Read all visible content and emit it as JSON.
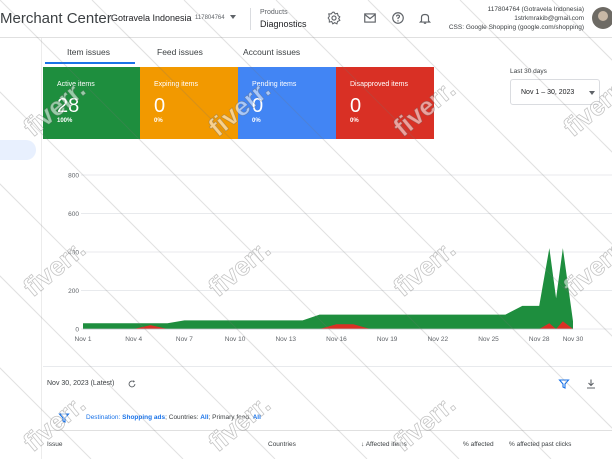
{
  "header": {
    "app_title": "Merchant Center",
    "account_name": "Gotravela Indonesia",
    "account_id": "117804764",
    "breadcrumb_parent": "Products",
    "breadcrumb_current": "Diagnostics",
    "account_lines": [
      "117804764 (Gotravela Indonesia)",
      "1strkmrakib@gmail.com",
      "CSS: Google Shopping (google.com/shopping)"
    ],
    "icons": [
      "settings-icon",
      "mail-icon",
      "help-icon",
      "notifications-icon"
    ]
  },
  "tabs": [
    {
      "label": "Item issues",
      "active": true
    },
    {
      "label": "Feed issues",
      "active": false
    },
    {
      "label": "Account issues",
      "active": false
    }
  ],
  "cards": [
    {
      "label": "Active items",
      "value": "28",
      "pct": "100%",
      "color": "#1e8e3e"
    },
    {
      "label": "Expiring items",
      "value": "0",
      "pct": "0%",
      "color": "#f29900"
    },
    {
      "label": "Pending items",
      "value": "0",
      "pct": "0%",
      "color": "#4285f4"
    },
    {
      "label": "Disapproved items",
      "value": "0",
      "pct": "0%",
      "color": "#d93025"
    }
  ],
  "date_range": {
    "label": "Last 30 days",
    "value": "Nov 1 – 30, 2023"
  },
  "chart_data": {
    "type": "area",
    "y_ticks": [
      "800",
      "600",
      "400",
      "200",
      "0"
    ],
    "ylim": [
      0,
      800
    ],
    "x_ticks": [
      "Nov 1",
      "Nov 4",
      "Nov 7",
      "Nov 10",
      "Nov 13",
      "Nov 16",
      "Nov 19",
      "Nov 22",
      "Nov 25",
      "Nov 28",
      "Nov 30"
    ],
    "x": [
      1,
      2,
      3,
      4,
      5,
      6,
      7,
      8,
      9,
      10,
      11,
      12,
      13,
      14,
      15,
      16,
      17,
      18,
      19,
      20,
      21,
      22,
      23,
      24,
      25,
      26,
      27,
      28,
      28.6,
      29,
      29.4,
      30
    ],
    "series": [
      {
        "color": "#1e8e3e",
        "values": [
          30,
          30,
          30,
          30,
          30,
          30,
          45,
          45,
          45,
          45,
          45,
          45,
          45,
          45,
          75,
          75,
          75,
          75,
          75,
          75,
          75,
          75,
          75,
          75,
          75,
          75,
          120,
          120,
          420,
          160,
          420,
          40
        ]
      },
      {
        "color": "#d93025",
        "values": [
          0,
          0,
          0,
          0,
          20,
          0,
          0,
          0,
          0,
          0,
          0,
          0,
          0,
          0,
          0,
          25,
          25,
          0,
          0,
          0,
          0,
          0,
          0,
          0,
          0,
          0,
          0,
          0,
          30,
          0,
          40,
          0
        ]
      }
    ],
    "grid": true
  },
  "issues": {
    "latest_label": "Nov 30, 2023 (Latest)",
    "filter": {
      "destination_key": "Destination:",
      "destination_val": "Shopping ads",
      "countries_key": "Countries:",
      "countries_val": "All",
      "feed_key": "Primary feed:",
      "feed_val": "All"
    },
    "columns": [
      "Issue",
      "Countries",
      "Affected items",
      "% affected",
      "% affected past clicks"
    ]
  },
  "watermark_text": "fiverr."
}
